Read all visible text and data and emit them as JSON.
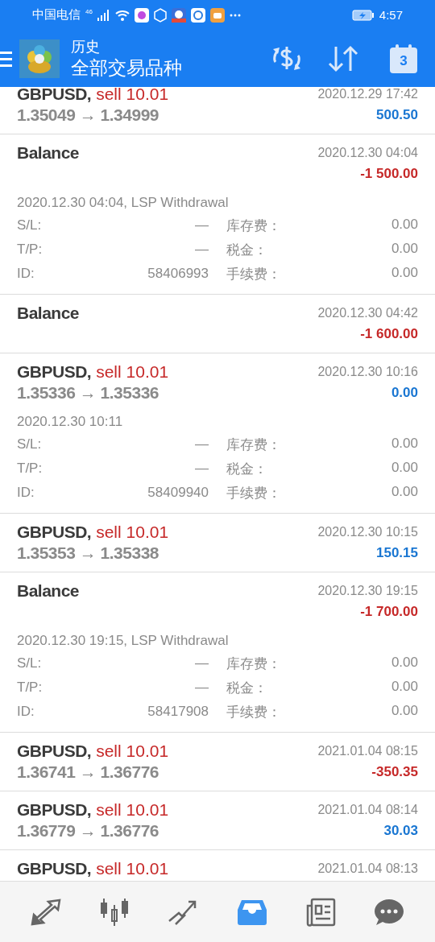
{
  "status_bar": {
    "carrier": "中国电信",
    "network": "46",
    "time": "4:57"
  },
  "header": {
    "title": "历史",
    "subtitle": "全部交易品种",
    "calendar_day": "3"
  },
  "items": [
    {
      "kind": "trade",
      "symbol": "GBPUSD,",
      "side": "sell 10.01",
      "time": "2020.12.29 17:42",
      "prices": "1.35049 → 1.34999",
      "profit": "500.50",
      "color": "#1976d2"
    },
    {
      "kind": "balance",
      "symbol": "Balance",
      "time": "2020.12.30 04:04",
      "profit": "-1 500.00",
      "color": "#c62828",
      "details": {
        "comment": "2020.12.30 04:04, LSP Withdrawal",
        "rows": [
          {
            "label": "S/L:",
            "value": "—",
            "label2": "库存费：",
            "value2": "0.00"
          },
          {
            "label": "T/P:",
            "value": "—",
            "label2": "税金：",
            "value2": "0.00"
          },
          {
            "label": "ID:",
            "value": "58406993",
            "label2": "手续费：",
            "value2": "0.00"
          }
        ]
      }
    },
    {
      "kind": "balance",
      "symbol": "Balance",
      "time": "2020.12.30 04:42",
      "profit": "-1 600.00",
      "color": "#c62828"
    },
    {
      "kind": "trade",
      "symbol": "GBPUSD,",
      "side": "sell 10.01",
      "time": "2020.12.30 10:16",
      "prices": "1.35336 → 1.35336",
      "profit": "0.00",
      "color": "#1976d2",
      "details": {
        "comment": "2020.12.30 10:11",
        "rows": [
          {
            "label": "S/L:",
            "value": "—",
            "label2": "库存费：",
            "value2": "0.00"
          },
          {
            "label": "T/P:",
            "value": "—",
            "label2": "税金：",
            "value2": "0.00"
          },
          {
            "label": "ID:",
            "value": "58409940",
            "label2": "手续费：",
            "value2": "0.00"
          }
        ]
      }
    },
    {
      "kind": "trade",
      "symbol": "GBPUSD,",
      "side": "sell 10.01",
      "time": "2020.12.30 10:15",
      "prices": "1.35353 → 1.35338",
      "profit": "150.15",
      "color": "#1976d2"
    },
    {
      "kind": "balance",
      "symbol": "Balance",
      "time": "2020.12.30 19:15",
      "profit": "-1 700.00",
      "color": "#c62828",
      "details": {
        "comment": "2020.12.30 19:15, LSP Withdrawal",
        "rows": [
          {
            "label": "S/L:",
            "value": "—",
            "label2": "库存费：",
            "value2": "0.00"
          },
          {
            "label": "T/P:",
            "value": "—",
            "label2": "税金：",
            "value2": "0.00"
          },
          {
            "label": "ID:",
            "value": "58417908",
            "label2": "手续费：",
            "value2": "0.00"
          }
        ]
      }
    },
    {
      "kind": "trade",
      "symbol": "GBPUSD,",
      "side": "sell 10.01",
      "time": "2021.01.04 08:15",
      "prices": "1.36741 → 1.36776",
      "profit": "-350.35",
      "color": "#c62828"
    },
    {
      "kind": "trade",
      "symbol": "GBPUSD,",
      "side": "sell 10.01",
      "time": "2021.01.04 08:14",
      "prices": "1.36779 → 1.36776",
      "profit": "30.03",
      "color": "#1976d2"
    },
    {
      "kind": "trade",
      "symbol": "GBPUSD,",
      "side": "sell 10.01",
      "time": "2021.01.04 08:13"
    }
  ],
  "tabs": [
    {
      "selected": false
    },
    {
      "selected": false
    },
    {
      "selected": false
    },
    {
      "selected": true
    },
    {
      "selected": false
    },
    {
      "selected": false
    }
  ]
}
